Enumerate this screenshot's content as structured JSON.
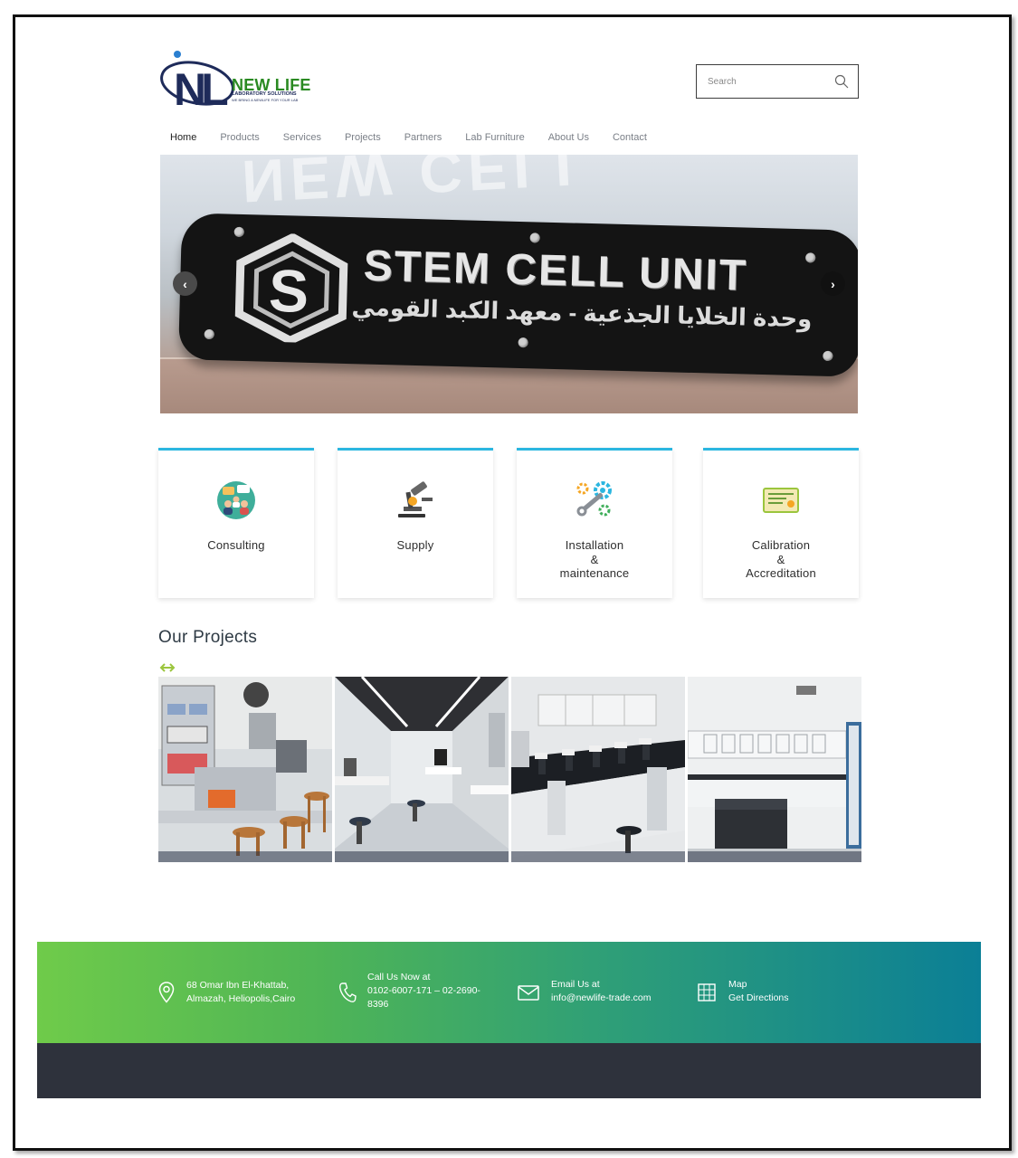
{
  "brand": {
    "name": "NEW LIFE",
    "initials": "NL",
    "subtitle": "LABORATORY SOLUTIONS",
    "tagline": "WE BRING A NEWLIFE FOR YOUR LAB"
  },
  "search": {
    "placeholder": "Search"
  },
  "nav": {
    "items": [
      {
        "label": "Home",
        "active": true
      },
      {
        "label": "Products"
      },
      {
        "label": "Services"
      },
      {
        "label": "Projects"
      },
      {
        "label": "Partners"
      },
      {
        "label": "Lab Furniture"
      },
      {
        "label": "About Us"
      },
      {
        "label": "Contact"
      }
    ]
  },
  "hero": {
    "sign_title": "STEM CELL UNIT",
    "sign_arabic": "وحدة الخلايا الجذعية - معهد الكبد القومي",
    "prev_label": "‹",
    "next_label": "›"
  },
  "services": [
    {
      "icon": "consulting-icon",
      "lines": [
        "Consulting"
      ]
    },
    {
      "icon": "microscope-icon",
      "lines": [
        "Supply"
      ]
    },
    {
      "icon": "gears-wrench-icon",
      "lines": [
        "Installation",
        "&",
        "maintenance"
      ]
    },
    {
      "icon": "certificate-icon",
      "lines": [
        "Calibration",
        "&",
        "Accreditation"
      ]
    }
  ],
  "projects": {
    "title": "Our Projects",
    "photos": [
      "electronics-lab-photo",
      "research-lab-photo",
      "microscope-lab-photo",
      "empty-lab-photo"
    ]
  },
  "footer": {
    "address": {
      "icon": "location-pin-icon",
      "line1": "68 Omar Ibn El-Khattab,",
      "line2": "Almazah, Heliopolis,Cairo"
    },
    "phone": {
      "icon": "phone-icon",
      "line1": "Call Us Now at",
      "line2": "0102-6007-171 – 02-2690-",
      "line3": "8396"
    },
    "email": {
      "icon": "envelope-icon",
      "line1": "Email Us at",
      "line2": "info@newlife-trade.com"
    },
    "map": {
      "icon": "map-grid-icon",
      "line1": "Map",
      "line2": "Get Directions"
    }
  },
  "colors": {
    "accent": "#2bb6e0",
    "brand_green": "#2a8a22",
    "brand_navy": "#1e2b5a",
    "footer_gradient_start": "#6fcb4a",
    "footer_gradient_end": "#0b7f96",
    "footer_bottom": "#2e323c"
  }
}
